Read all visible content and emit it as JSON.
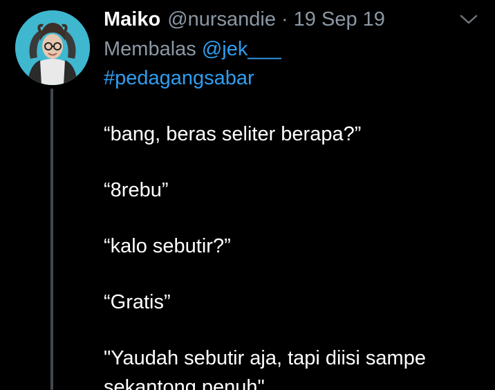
{
  "author": {
    "display_name": "Maiko",
    "handle": "@nursandie",
    "separator": "·",
    "timestamp": "19 Sep 19",
    "avatar_icon": "user-avatar-photo"
  },
  "reply": {
    "prefix": "Membalas",
    "handle": "@jek___"
  },
  "tweet": {
    "hashtag": "#pedagangsabar",
    "lines": [
      "“bang, beras seliter berapa?”",
      "“8rebu”",
      "“kalo sebutir?”",
      "“Gratis”",
      "\"Yaudah sebutir aja, tapi diisi sampe",
      "sekantong penuh\""
    ]
  },
  "menu": {
    "icon": "chevron-down-icon"
  },
  "colors": {
    "background": "#000000",
    "text": "#ffffff",
    "muted": "#8b98a5",
    "accent": "#2f9ef0",
    "thread_line": "#42474c"
  }
}
